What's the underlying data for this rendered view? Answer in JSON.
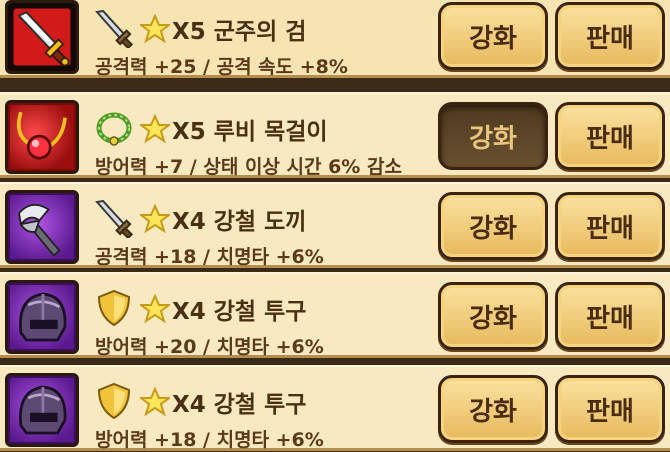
{
  "items": [
    {
      "name": "X5 군주의 검",
      "stats": "공격력 +25 / 공격 속도 +8%",
      "type_icon": "sword-icon",
      "item_icon": "greatsword-icon",
      "frame": "red",
      "upgrade_label": "강화",
      "sell_label": "판매",
      "upgrade_pressed": false
    },
    {
      "name": "X5 루비 목걸이",
      "stats": "방어력 +7 / 상태 이상 시간 6% 감소",
      "type_icon": "necklace-icon",
      "item_icon": "ruby-necklace-icon",
      "frame": "red2",
      "upgrade_label": "강화",
      "sell_label": "판매",
      "upgrade_pressed": true
    },
    {
      "name": "X4 강철 도끼",
      "stats": "공격력 +18 / 치명타 +6%",
      "type_icon": "sword-icon",
      "item_icon": "axe-icon",
      "frame": "purple",
      "upgrade_label": "강화",
      "sell_label": "판매",
      "upgrade_pressed": false
    },
    {
      "name": "X4 강철 투구",
      "stats": "방어력 +20 / 치명타 +6%",
      "type_icon": "shield-icon",
      "item_icon": "helmet-icon",
      "frame": "purple",
      "upgrade_label": "강화",
      "sell_label": "판매",
      "upgrade_pressed": false
    },
    {
      "name": "X4 강철 투구",
      "stats": "방어력 +18 / 치명타 +6%",
      "type_icon": "shield-icon",
      "item_icon": "helmet-icon",
      "frame": "purple",
      "upgrade_label": "강화",
      "sell_label": "판매",
      "upgrade_pressed": false
    }
  ]
}
